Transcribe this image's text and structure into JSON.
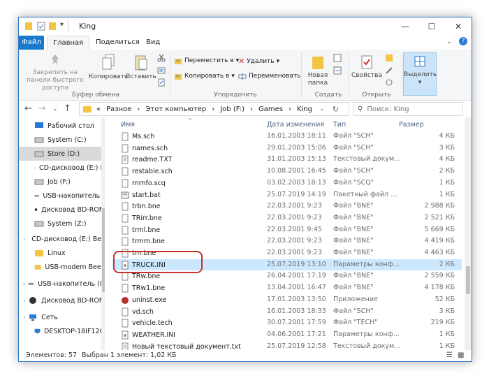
{
  "window": {
    "title": "King"
  },
  "ribbon_tabs": [
    "Файл",
    "Главная",
    "Поделиться",
    "Вид"
  ],
  "ribbon": {
    "pin_label": "Закрепить на панели быстрого доступа",
    "copy_label": "Копировать",
    "paste_label": "Вставить",
    "clipboard_group": "Буфер обмена",
    "move_to_label": "Переместить в",
    "copy_to_label": "Копировать в",
    "delete_label": "Удалить",
    "rename_label": "Переименовать",
    "organize_group": "Упорядочить",
    "new_folder_label": "Новая папка",
    "create_group": "Создать",
    "properties_label": "Свойства",
    "open_group": "Открыть",
    "select_label": "Выделить"
  },
  "address": {
    "segments": [
      "«",
      "Разное",
      "›",
      "Этот компьютер",
      "›",
      "Job (F:)",
      "›",
      "Games",
      "›",
      "King"
    ],
    "search_placeholder": "Поиск: King"
  },
  "nav_items": [
    {
      "label": "Рабочий стол",
      "icon": "desktop-icon"
    },
    {
      "label": "System (C:)",
      "icon": "drive-icon"
    },
    {
      "label": "Store (D:)",
      "icon": "drive-icon",
      "selected": true
    },
    {
      "label": "CD-дисковод (E:) B",
      "icon": "cd-drive-icon"
    },
    {
      "label": "Job (F:)",
      "icon": "drive-icon"
    },
    {
      "label": "USB-накопитель (",
      "icon": "usb-drive-icon"
    },
    {
      "label": "Дисковод BD-ROM",
      "icon": "bd-rom-icon"
    },
    {
      "label": "System (Z:)",
      "icon": "drive-icon"
    },
    {
      "label": "CD-дисковод (E:) Bee",
      "icon": "cd-drive-icon"
    },
    {
      "label": "Linux",
      "icon": "folder-icon"
    },
    {
      "label": "USB-modem Beeli",
      "icon": "folder-icon"
    },
    {
      "label": "USB-накопитель (H",
      "icon": "usb-drive-icon"
    },
    {
      "label": "Дисковод BD-ROM",
      "icon": "bd-rom-icon"
    },
    {
      "label": "Сеть",
      "icon": "network-icon"
    },
    {
      "label": "DESKTOP-18IF12O",
      "icon": "computer-icon"
    }
  ],
  "columns": {
    "name": "Имя",
    "date": "Дата изменения",
    "type": "Тип",
    "size": "Размер"
  },
  "files": [
    {
      "name": "Ms.sch",
      "date": "16.01.2003 18:11",
      "type": "Файл \"SCH\"",
      "size": "4 КБ"
    },
    {
      "name": "names.sch",
      "date": "29.01.2003 15:06",
      "type": "Файл \"SCH\"",
      "size": "3 КБ"
    },
    {
      "name": "readme.TXT",
      "date": "31.01.2003 15:13",
      "type": "Текстовый докум...",
      "size": "4 КБ"
    },
    {
      "name": "restable.sch",
      "date": "10.08.2001 16:45",
      "type": "Файл \"SCH\"",
      "size": "2 КБ"
    },
    {
      "name": "rnrnfo.scq",
      "date": "03.02.2003 18:13",
      "type": "Файл \"SCQ\"",
      "size": "1 КБ"
    },
    {
      "name": "start.bat",
      "date": "25.07.2019 14:19",
      "type": "Пакетный файл ...",
      "size": "1 КБ"
    },
    {
      "name": "trbn.bne",
      "date": "22.03.2001 9:23",
      "type": "Файл \"BNE\"",
      "size": "2 988 КБ"
    },
    {
      "name": "TRirr.bne",
      "date": "22.03.2001 9:23",
      "type": "Файл \"BNE\"",
      "size": "2 521 КБ"
    },
    {
      "name": "trml.bne",
      "date": "22.03.2001 9:45",
      "type": "Файл \"BNE\"",
      "size": "5 669 КБ"
    },
    {
      "name": "trmm.bne",
      "date": "22.03.2001 9:23",
      "type": "Файл \"BNE\"",
      "size": "4 419 КБ"
    },
    {
      "name": "trn.bne",
      "date": "22.03.2001 9:23",
      "type": "Файл \"BNE\"",
      "size": "4 463 КБ"
    },
    {
      "name": "TRUCK.INI",
      "date": "25.07.2019 13:10",
      "type": "Параметры конф...",
      "size": "2 КБ",
      "selected": true
    },
    {
      "name": "TRw.bne",
      "date": "26.04.2001 17:19",
      "type": "Файл \"BNE\"",
      "size": "2 559 КБ"
    },
    {
      "name": "TRw1.bne",
      "date": "13.04.2001 16:47",
      "type": "Файл \"BNE\"",
      "size": "4 178 КБ"
    },
    {
      "name": "uninst.exe",
      "date": "17.01.2003 13:50",
      "type": "Приложение",
      "size": "52 КБ"
    },
    {
      "name": "vd.sch",
      "date": "16.01.2003 18:33",
      "type": "Файл \"SCH\"",
      "size": "3 КБ"
    },
    {
      "name": "vehicle.tech",
      "date": "30.07.2001 17:59",
      "type": "Файл \"TECH\"",
      "size": "219 КБ"
    },
    {
      "name": "WEATHER.INI",
      "date": "04.06.2001 17:21",
      "type": "Параметры конф...",
      "size": "1 КБ"
    },
    {
      "name": "Новый текстовый документ.txt",
      "date": "25.07.2019 12:58",
      "type": "Текстовый докум...",
      "size": "1 КБ"
    }
  ],
  "status": {
    "count": "Элементов: 57",
    "selection": "Выбран 1 элемент: 1,02 КБ"
  },
  "colors": {
    "accent": "#1979ca",
    "selection": "#cce8ff",
    "highlight_box": "#c9302c",
    "folder": "#f3c343"
  }
}
